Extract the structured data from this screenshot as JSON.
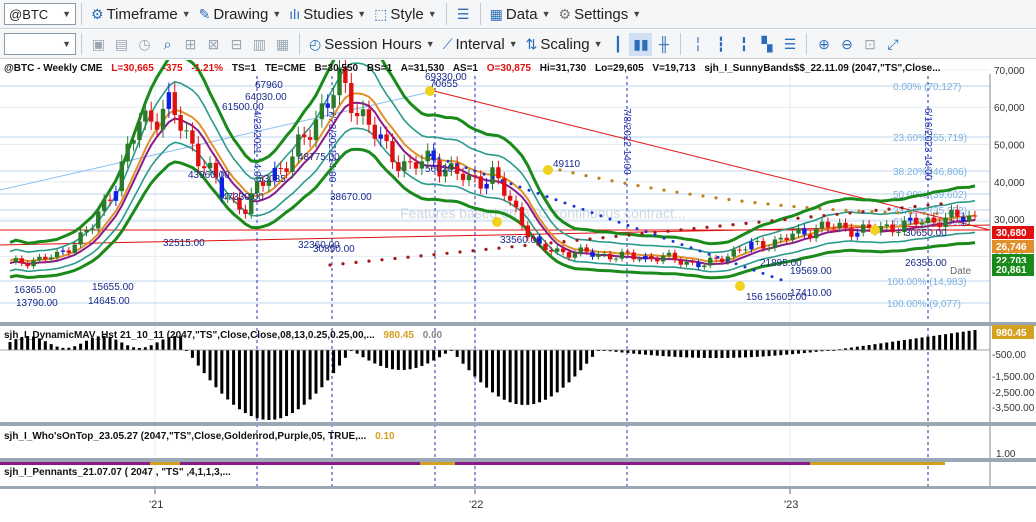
{
  "toolbar1": {
    "symbol": "@BTC",
    "timeframe": "Timeframe",
    "drawing": "Drawing",
    "studies": "Studies",
    "style": "Style",
    "data": "Data",
    "settings": "Settings"
  },
  "toolbar2": {
    "symbol_box": "",
    "session_hours": "Session Hours",
    "interval": "Interval",
    "scaling": "Scaling"
  },
  "header": {
    "symbol": "@BTC - Weekly  CME",
    "l": "L=30,665",
    "chg": "-375",
    "pct": "-1.21%",
    "ts": "TS=1",
    "te": "TE=CME",
    "b": "B=30,550",
    "bs": "BS=1",
    "a": "A=31,530",
    "as": "AS=1",
    "o": "O=30,875",
    "hi": "Hi=31,730",
    "lo": "Lo=29,605",
    "v": "V=19,713",
    "study": "sjh_I_SunnyBands$$_22.11.09 (2047,\"TS\",Close..."
  },
  "watermark": "Features based on BTC continuous contract...",
  "colors": {
    "up": "#2a7a2a",
    "down": "#e01010",
    "blue": "#1020e0",
    "band_outer": "#1a8a1a",
    "band_inner": "#2a9a8a",
    "orange": "#e0902a",
    "purple": "#8a1a8a",
    "gold": "#d4a020",
    "fib": "#7ab0e0"
  },
  "price_axis": {
    "ticks": [
      "70,000",
      "60,000",
      "50,000",
      "40,000",
      "30,000",
      "20,000"
    ],
    "badges": [
      {
        "text": "30,680",
        "bg": "#e01010"
      },
      {
        "text": "26,746",
        "bg": "#e0902a"
      },
      {
        "text": "22,703",
        "bg": "#1a8a1a"
      },
      {
        "text": "20,861",
        "bg": "#1a8a1a"
      }
    ]
  },
  "fib_labels": [
    "0.00% (70,127)",
    "23.60% (55,719)",
    "38.20% (46,806)",
    "50.00% (39,602)",
    "23.60% (35,252)",
    "61.80% (32,398)",
    "100.00% (14,983)",
    "100.00% (9,077)"
  ],
  "date_labels": [
    "4/23/2021 14:00",
    "7/23/2021 14:00",
    "7/8/2022 14:00",
    "6/16/2023 14:00"
  ],
  "price_labels": [
    "69330.00",
    "67960",
    "70655",
    "64030.00",
    "61500.00",
    "48775.00",
    "53035.",
    "43960.00",
    "47330.00",
    "38670.00",
    "32515.00",
    "32360.00",
    "30890.00",
    "56020.",
    "49110",
    "33560.00",
    "21895.00",
    "19569.00",
    "17410.00",
    "15605.00",
    "156",
    "30650.00",
    "26355.00",
    "13790.00",
    "14645.00",
    "15655.00",
    "16365.00"
  ],
  "mid_labels": [
    "Date"
  ],
  "panels": {
    "dmav": {
      "title": "sjh_I_DynamicMAV_Hst 21_10_11 (2047,\"TS\",Close,Close,08,13,0.25,0.25,00,...",
      "v1": "980.45",
      "v2": "0.00",
      "badge": "980.45"
    },
    "dmav_ticks": [
      "-500.00",
      "-1,500.00",
      "-2,500.00",
      "-3,500.00"
    ],
    "wot": {
      "title": "sjh_I_Who'sOnTop_23.05.27 (2047,\"TS\",Close,Goldenrod,Purple,05,  TRUE,...",
      "v": "0.10"
    },
    "wot_tick": "1.00",
    "pen": {
      "title": "sjh_I_Pennants_21.07.07 ( 2047 , \"TS\" ,4,1,1,3,..."
    }
  },
  "time_axis": [
    "'21",
    "'22",
    "'23"
  ]
}
